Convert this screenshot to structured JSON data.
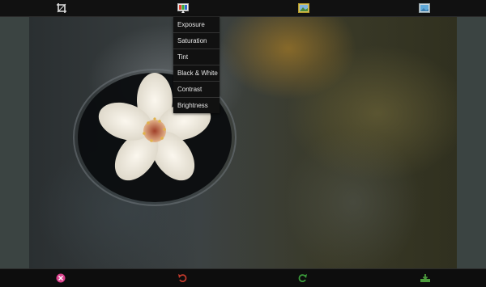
{
  "colors": {
    "bar_background": "#111111",
    "side_panel": "#3b4442",
    "menu_background": "#111111",
    "menu_text": "#e6e6e6",
    "cancel_pink": "#d9418c",
    "undo_red": "#c0392b",
    "redo_green": "#3a9a3a",
    "save_green": "#4c9a3c"
  },
  "toolbar": {
    "icons": [
      "crop-icon",
      "effects-icon",
      "photo-frame-icon",
      "image-icon"
    ]
  },
  "filters_menu": {
    "items": [
      {
        "label": "Exposure"
      },
      {
        "label": "Saturation"
      },
      {
        "label": "Tint"
      },
      {
        "label": "Black & White"
      },
      {
        "label": "Contrast"
      },
      {
        "label": "Brightness"
      }
    ]
  },
  "bottombar": {
    "icons": [
      "cancel-icon",
      "undo-icon",
      "redo-icon",
      "save-icon"
    ]
  }
}
